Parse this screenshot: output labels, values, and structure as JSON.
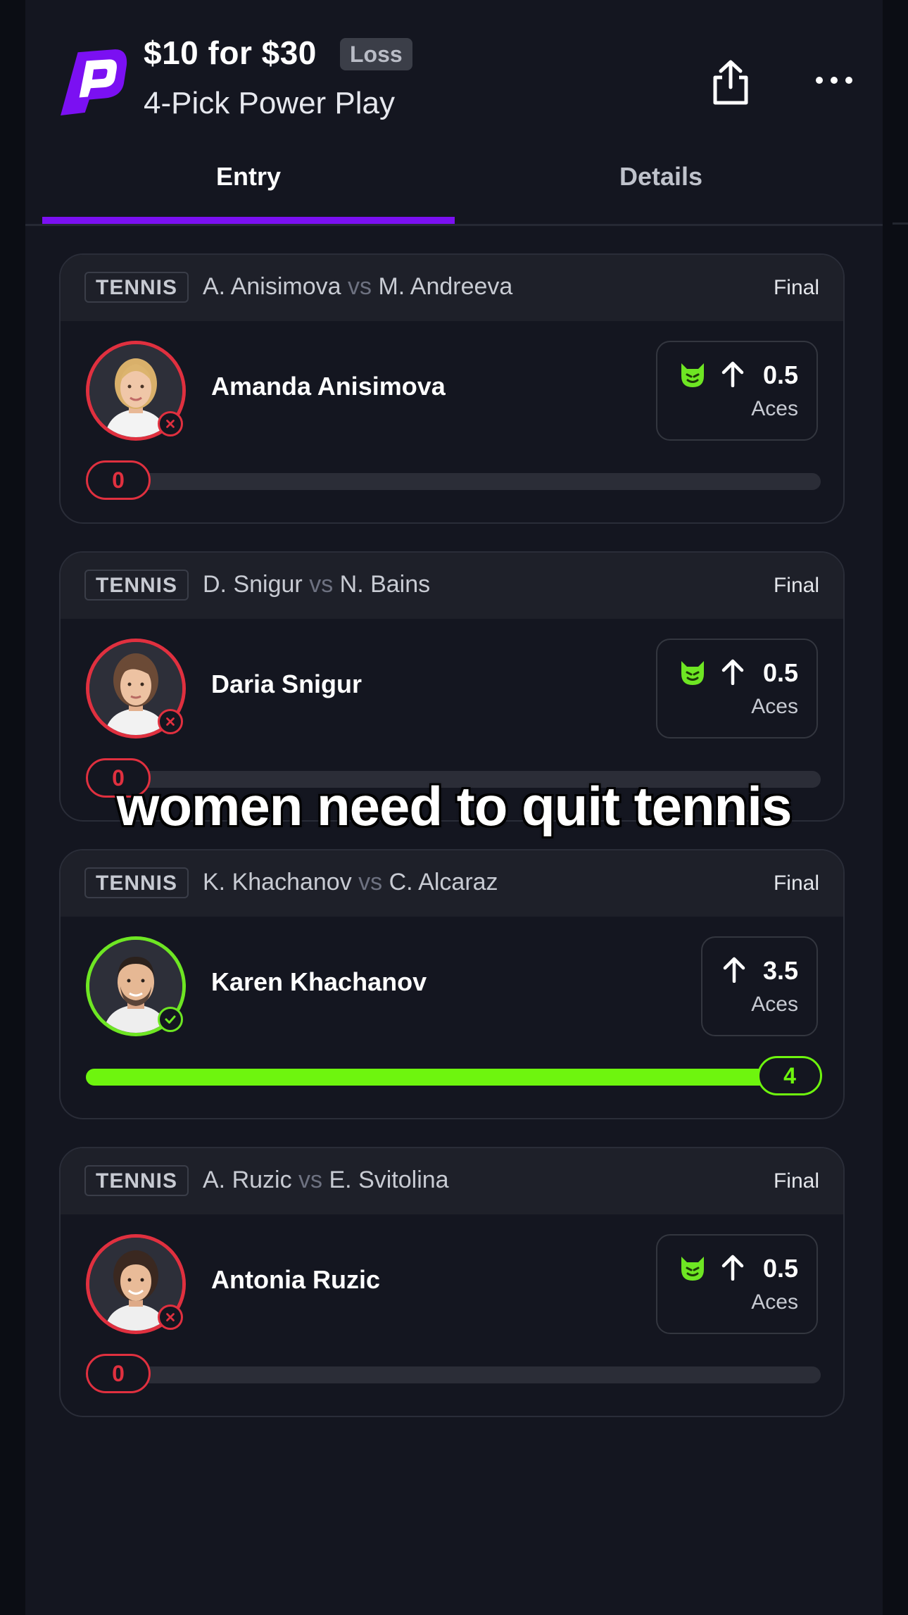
{
  "header": {
    "title": "$10 for $30",
    "result_badge": "Loss",
    "subtitle": "4-Pick Power Play",
    "icons": [
      "prizepicks-logo",
      "share-icon",
      "more-icon"
    ]
  },
  "tabs": [
    {
      "label": "Entry",
      "active": true
    },
    {
      "label": "Details",
      "active": false
    }
  ],
  "colors": {
    "accent": "#7b10f2",
    "win": "#6ef50e",
    "loss": "#e0303f",
    "background": "#141620"
  },
  "picks": [
    {
      "sport": "TENNIS",
      "player_a": "A. Anisimova",
      "vs": "vs",
      "player_b": "M. Andreeva",
      "status": "Final",
      "player": "Amanda Anisimova",
      "result": "loss",
      "direction": "more",
      "line": "0.5",
      "stat": "Aces",
      "demon": true,
      "actual": "0",
      "progress": 0
    },
    {
      "sport": "TENNIS",
      "player_a": "D. Snigur",
      "vs": "vs",
      "player_b": "N. Bains",
      "status": "Final",
      "player": "Daria Snigur",
      "result": "loss",
      "direction": "more",
      "line": "0.5",
      "stat": "Aces",
      "demon": true,
      "actual": "0",
      "progress": 0
    },
    {
      "sport": "TENNIS",
      "player_a": "K. Khachanov",
      "vs": "vs",
      "player_b": "C. Alcaraz",
      "status": "Final",
      "player": "Karen Khachanov",
      "result": "win",
      "direction": "more",
      "line": "3.5",
      "stat": "Aces",
      "demon": false,
      "actual": "4",
      "progress": 1
    },
    {
      "sport": "TENNIS",
      "player_a": "A. Ruzic",
      "vs": "vs",
      "player_b": "E. Svitolina",
      "status": "Final",
      "player": "Antonia Ruzic",
      "result": "loss",
      "direction": "more",
      "line": "0.5",
      "stat": "Aces",
      "demon": true,
      "actual": "0",
      "progress": 0
    }
  ],
  "caption": "women need to quit tennis"
}
